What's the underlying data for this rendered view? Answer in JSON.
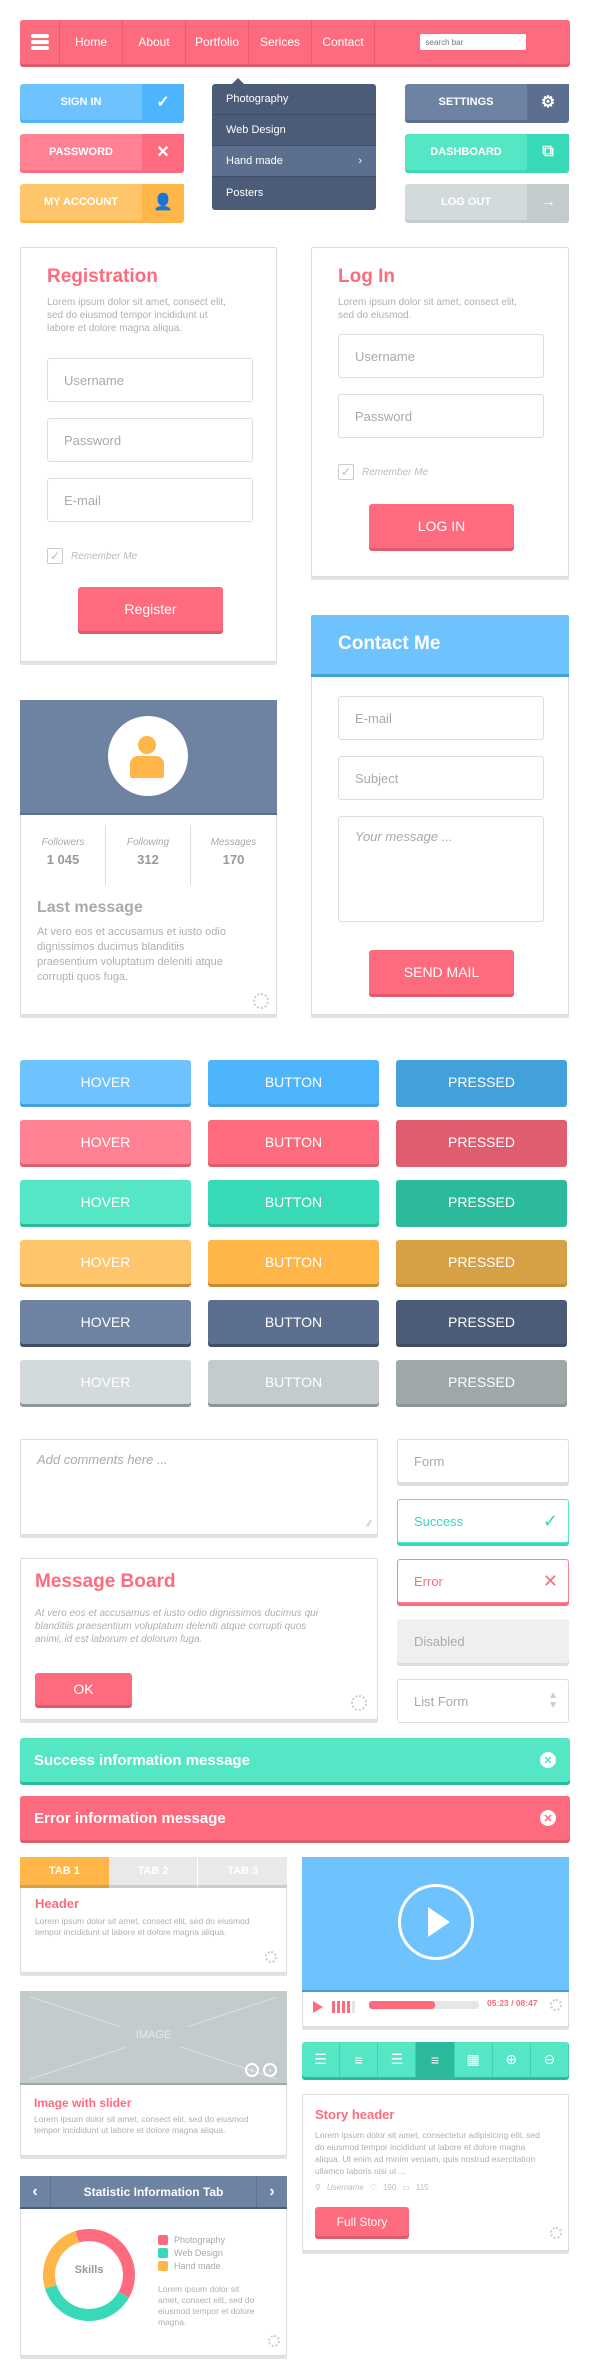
{
  "nav": {
    "menu_icon": "hamburger-icon",
    "items": [
      "Home",
      "About",
      "Portfolio",
      "Serices",
      "Contact"
    ],
    "search_placeholder": "search bar"
  },
  "left_buttons": [
    {
      "label": "SIGN IN",
      "icon": "check-icon",
      "glyph": "✓",
      "color": "#6ec3ff",
      "icon_bg": "#4db5fb"
    },
    {
      "label": "PASSWORD",
      "icon": "close-icon",
      "glyph": "✕",
      "color": "#ff8193",
      "icon_bg": "#ff6b7e"
    },
    {
      "label": "MY ACCOUNT",
      "icon": "user-icon",
      "glyph": "👤",
      "color": "#ffc56a",
      "icon_bg": "#ffb547"
    }
  ],
  "dropdown": {
    "items": [
      "Photography",
      "Web Design",
      "Hand made",
      "Posters"
    ],
    "active_index": 2
  },
  "right_buttons": [
    {
      "label": "SETTINGS",
      "icon": "gear-icon",
      "glyph": "⚙",
      "color": "#6e82a2",
      "icon_bg": "#5c6f8f"
    },
    {
      "label": "DASHBOARD",
      "icon": "external-link-icon",
      "glyph": "⧉",
      "color": "#55e6c6",
      "icon_bg": "#37d9b6"
    },
    {
      "label": "LOG OUT",
      "icon": "arrow-right-icon",
      "glyph": "→",
      "color": "#d3dadb",
      "icon_bg": "#c3cbcc"
    }
  ],
  "registration": {
    "title": "Registration",
    "text": "Lorem ipsum dolor sit amet, consect elit, sed do eiusmod tempor incididunt ut labore et dolore magna aliqua.",
    "fields": [
      "Username",
      "Password",
      "E-mail"
    ],
    "remember": "Remember Me",
    "button": "Register"
  },
  "login": {
    "title": "Log In",
    "text": "Lorem ipsum dolor sit amet, consect elit, sed do eiusmod.",
    "fields": [
      "Username",
      "Password"
    ],
    "remember": "Remember Me",
    "button": "LOG IN"
  },
  "contact": {
    "title": "Contact Me",
    "fields": [
      "E-mail",
      "Subject"
    ],
    "message_placeholder": "Your message ...",
    "button": "SEND MAIL"
  },
  "profile": {
    "stats": [
      {
        "label": "Followers",
        "value": "1 045"
      },
      {
        "label": "Following",
        "value": "312"
      },
      {
        "label": "Messages",
        "value": "170"
      }
    ],
    "last_message_title": "Last message",
    "last_message_text": "At vero eos et accusamus et iusto odio dignissimos ducimus blanditiis praesentium voluptatum deleniti atque corrupti quos  fuga."
  },
  "button_grid": {
    "labels": [
      "HOVER",
      "BUTTON",
      "PRESSED"
    ],
    "rows": [
      [
        "#6ec3ff",
        "#4db5fb",
        "#42a0db"
      ],
      [
        "#ff8193",
        "#ff6b7e",
        "#de5d6f"
      ],
      [
        "#55e6c6",
        "#37d9b6",
        "#2bba9b"
      ],
      [
        "#ffc56a",
        "#ffb547",
        "#d6a045"
      ],
      [
        "#6e82a2",
        "#5c6f8f",
        "#4b5b78"
      ],
      [
        "#d3dadb",
        "#c3cbcc",
        "#9fa8a9"
      ]
    ]
  },
  "comments": {
    "placeholder": "Add comments here ..."
  },
  "message_board": {
    "title": "Message Board",
    "text": "At vero eos et accusamus et iusto odio dignissimos ducimus qui blanditiis praesentium voluptatum deleniti atque corrupti quos animi, id est laborum et dolorum fuga.",
    "button": "OK"
  },
  "form_states": {
    "form": "Form",
    "success": "Success",
    "error": "Error",
    "disabled": "Disabled",
    "list": "List Form"
  },
  "alerts": {
    "success": "Success information message",
    "error": "Error information message"
  },
  "tabs": {
    "labels": [
      "TAB 1",
      "TAB 2",
      "TAB 3"
    ],
    "active_index": 0,
    "header": "Header",
    "text": "Lorem ipsum dolor sit amet, consect elit, sed do eiusmod tempor incididunt ut labore et dolore magna aliqua."
  },
  "video": {
    "time": "05:23 / 08:47",
    "progress": 0.6,
    "volume_bars_on": 4,
    "volume_bars_total": 5
  },
  "toolbar": {
    "icons": [
      "align-left-icon",
      "align-center-icon",
      "align-justify-icon",
      "align-right-icon",
      "grid-icon",
      "zoom-in-icon",
      "zoom-out-icon"
    ],
    "active_index": 3
  },
  "image_slider": {
    "placeholder": "IMAGE",
    "title": "Image with slider",
    "text": "Lorem ipsum dolor sit amet, consect elit, sed do eiusmod tempor incididunt ut labore et dolore magna aliqua."
  },
  "story": {
    "title": "Story header",
    "text": "Lorem ipsum dolor sit amet, consectetur adipisicing elit, sed do eiusmod tempor incididunt ut labore et dolore magna aliqua. Ut enim ad minim veniam, quis nostrud exercitation ullamco laboris nisi ut ...",
    "user": "Username",
    "likes": "190",
    "comments": "115",
    "button": "Full Story"
  },
  "stats_tab": {
    "title": "Statistic Information Tab",
    "center_label": "Skills",
    "text": "Lorem ipsum dolor sit amet, consect elit, sed do eiusmod tempor et dolore magna."
  },
  "chart_data": {
    "type": "pie",
    "title": "Skills",
    "categories": [
      "Photography",
      "Web Design",
      "Hand made"
    ],
    "values": [
      38,
      37,
      25
    ],
    "colors": [
      "#ff6b7e",
      "#37d9b6",
      "#ffb547"
    ],
    "legend": "right"
  }
}
